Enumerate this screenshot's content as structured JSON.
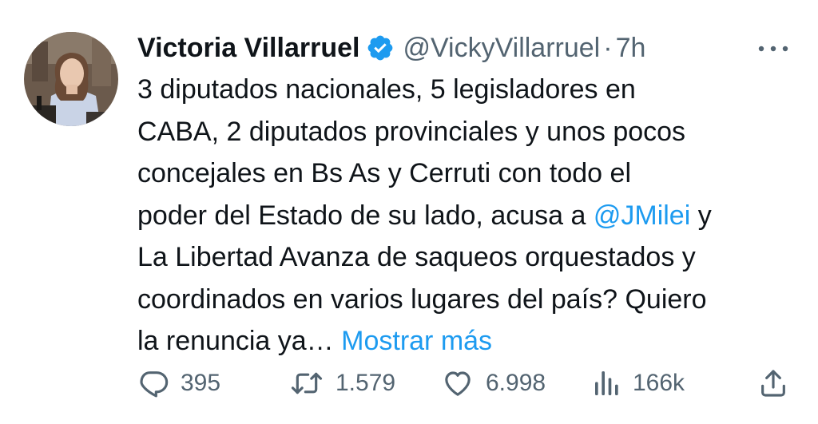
{
  "tweet": {
    "display_name": "Victoria Villarruel",
    "handle": "@VickyVillarruel",
    "separator": "·",
    "time": "7h",
    "verified_icon": "verified-badge-icon",
    "more_icon": "more-options-icon",
    "text_lines": [
      [
        "3 diputados nacionales, 5 legisladores en"
      ],
      [
        "CABA, 2 diputados provinciales y unos pocos"
      ],
      [
        "concejales en Bs As y Cerruti con todo el"
      ],
      [
        "poder del Estado de su lado, acusa a ",
        "@JMilei",
        " y"
      ],
      [
        "La Libertad Avanza de saqueos orquestados y"
      ],
      [
        "coordinados en varios lugares del país? Quiero"
      ],
      [
        "la renuncia ya… ",
        "Mostrar más"
      ]
    ],
    "mention": "@JMilei",
    "show_more": "Mostrar más",
    "actions": {
      "reply": {
        "icon": "reply-icon",
        "count": "395"
      },
      "retweet": {
        "icon": "retweet-icon",
        "count": "1.579"
      },
      "like": {
        "icon": "heart-icon",
        "count": "6.998"
      },
      "views": {
        "icon": "views-chart-icon",
        "count": "166k"
      },
      "share": {
        "icon": "share-icon"
      }
    },
    "colors": {
      "text": "#0f1419",
      "secondary": "#536471",
      "link": "#1d9bf0",
      "verified": "#1d9bf0"
    }
  }
}
